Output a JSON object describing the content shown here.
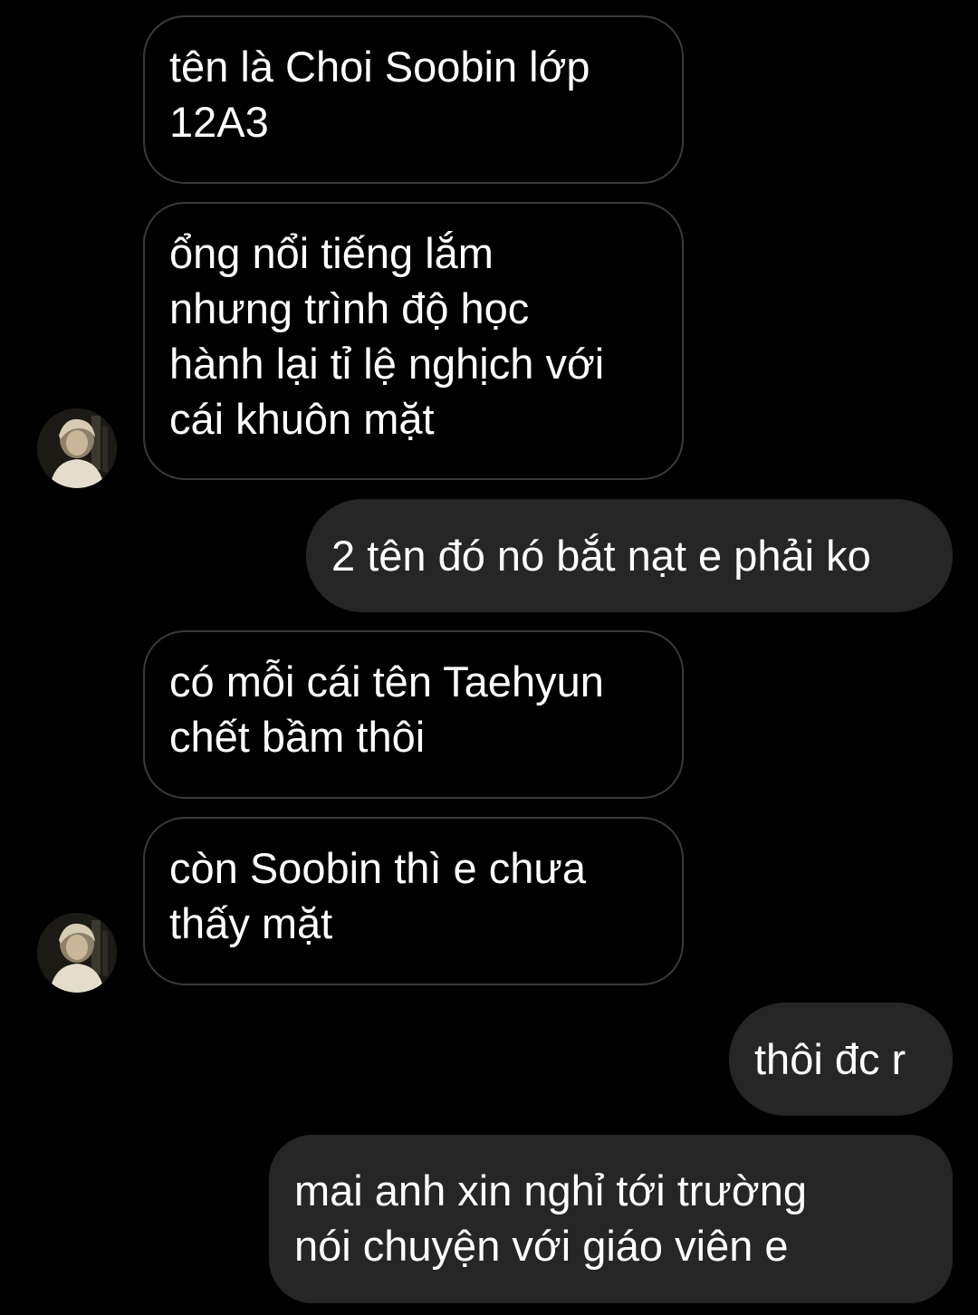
{
  "messages": [
    {
      "sender": "other",
      "text": "tên là Choi Soobin lớp\n12A3"
    },
    {
      "sender": "other",
      "text": "ổng nổi tiếng lắm\nnhưng trình độ học\nhành lại tỉ lệ nghịch với\ncái khuôn mặt"
    },
    {
      "sender": "me",
      "text": "2 tên đó nó bắt nạt e phải ko"
    },
    {
      "sender": "other",
      "text": "có mỗi cái tên Taehyun\nchết bầm thôi"
    },
    {
      "sender": "other",
      "text": "còn Soobin thì e chưa\nthấy mặt"
    },
    {
      "sender": "me",
      "text": "thôi đc r"
    },
    {
      "sender": "me",
      "text": "mai anh xin nghỉ tới trường\nnói chuyện với giáo viên e"
    }
  ],
  "colors": {
    "background": "#000000",
    "incoming_bubble_border": "#3a3a3a",
    "outgoing_bubble": "#262626",
    "text": "#ffffff"
  },
  "icons": {
    "avatar": "contact-avatar-photo"
  }
}
